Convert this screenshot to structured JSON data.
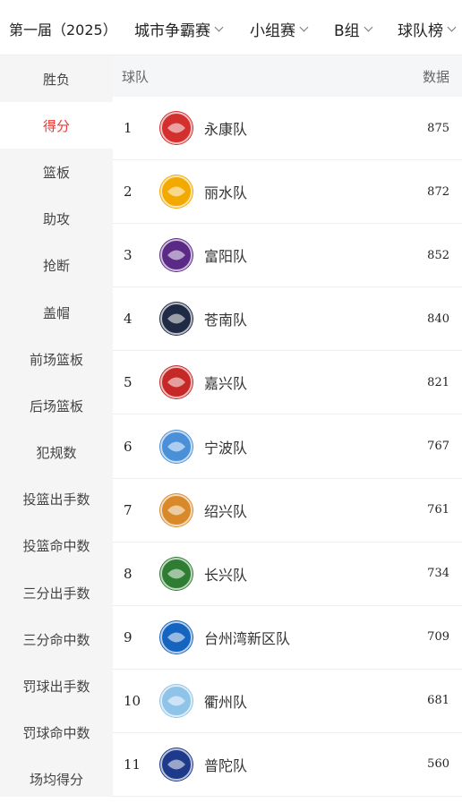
{
  "header": {
    "season": "第一届（2025）",
    "filters": [
      "城市争霸赛",
      "小组赛",
      "B组",
      "球队榜"
    ]
  },
  "sidebar": {
    "items": [
      "胜负",
      "得分",
      "篮板",
      "助攻",
      "抢断",
      "盖帽",
      "前场篮板",
      "后场篮板",
      "犯规数",
      "投篮出手数",
      "投篮命中数",
      "三分出手数",
      "三分命中数",
      "罚球出手数",
      "罚球命中数",
      "场均得分"
    ],
    "active_index": 1,
    "active_color": "#e53935"
  },
  "table": {
    "col_team": "球队",
    "col_value": "数据",
    "rows": [
      {
        "rank": "1",
        "team": "永康队",
        "value": "875",
        "logo_color": "#d32f2f",
        "logo_icon": "yongkang-logo"
      },
      {
        "rank": "2",
        "team": "丽水队",
        "value": "872",
        "logo_color": "#f2a900",
        "logo_icon": "lishui-logo"
      },
      {
        "rank": "3",
        "team": "富阳队",
        "value": "852",
        "logo_color": "#5b2a86",
        "logo_icon": "fuyang-logo"
      },
      {
        "rank": "4",
        "team": "苍南队",
        "value": "840",
        "logo_color": "#1f2a44",
        "logo_icon": "cangnan-logo"
      },
      {
        "rank": "5",
        "team": "嘉兴队",
        "value": "821",
        "logo_color": "#c62828",
        "logo_icon": "jiaxing-logo"
      },
      {
        "rank": "6",
        "team": "宁波队",
        "value": "767",
        "logo_color": "#4a90d9",
        "logo_icon": "ningbo-logo"
      },
      {
        "rank": "7",
        "team": "绍兴队",
        "value": "761",
        "logo_color": "#d88a2b",
        "logo_icon": "shaoxing-logo"
      },
      {
        "rank": "8",
        "team": "长兴队",
        "value": "734",
        "logo_color": "#2e7d32",
        "logo_icon": "changxing-logo"
      },
      {
        "rank": "9",
        "team": "台州湾新区队",
        "value": "709",
        "logo_color": "#1565c0",
        "logo_icon": "taizhouwan-logo"
      },
      {
        "rank": "10",
        "team": "衢州队",
        "value": "681",
        "logo_color": "#8fc3e8",
        "logo_icon": "quzhou-logo"
      },
      {
        "rank": "11",
        "team": "普陀队",
        "value": "560",
        "logo_color": "#1e3a8a",
        "logo_icon": "putuo-logo"
      }
    ]
  }
}
